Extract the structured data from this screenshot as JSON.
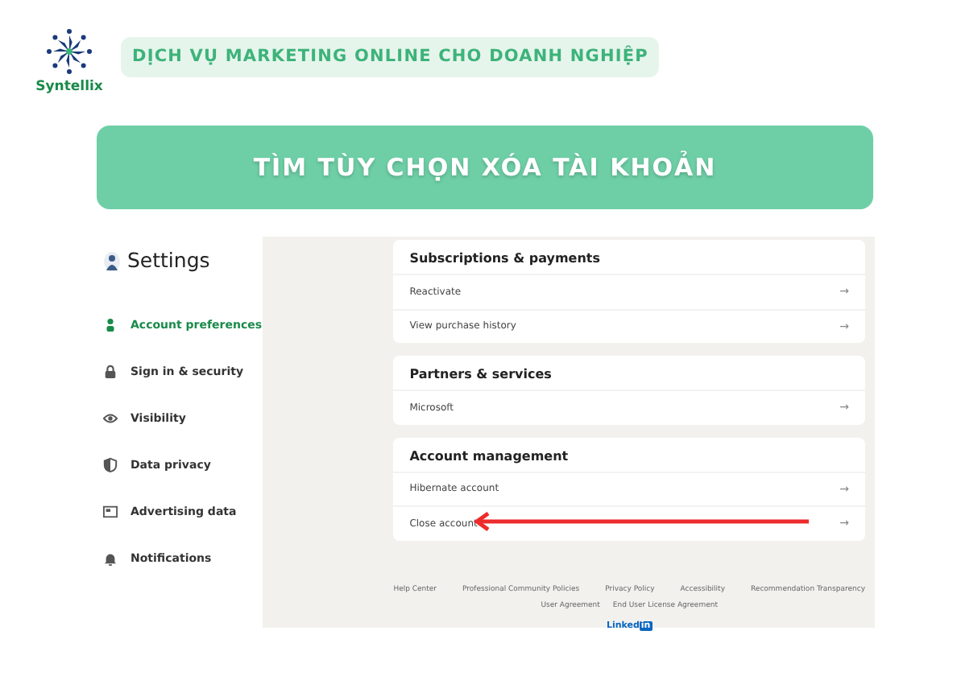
{
  "brand": {
    "name": "Syntellix",
    "tagline": "DỊCH VỤ MARKETING ONLINE CHO DOANH NGHIỆP"
  },
  "banner": {
    "title": "TÌM TÙY CHỌN XÓA TÀI KHOẢN"
  },
  "screenshot": {
    "sidebar": {
      "title": "Settings",
      "items": [
        {
          "label": "Account preferences",
          "selected": true
        },
        {
          "label": "Sign in & security",
          "selected": false
        },
        {
          "label": "Visibility",
          "selected": false
        },
        {
          "label": "Data privacy",
          "selected": false
        },
        {
          "label": "Advertising data",
          "selected": false
        },
        {
          "label": "Notifications",
          "selected": false
        }
      ]
    },
    "sections": [
      {
        "title": "Subscriptions & payments",
        "rows": [
          {
            "label": "Reactivate",
            "arrow": "→",
            "highlighted": false
          },
          {
            "label": "View purchase history",
            "arrow": "→",
            "highlighted": false
          }
        ]
      },
      {
        "title": "Partners & services",
        "rows": [
          {
            "label": "Microsoft",
            "arrow": "→",
            "highlighted": false
          }
        ]
      },
      {
        "title": "Account management",
        "rows": [
          {
            "label": "Hibernate account",
            "arrow": "→",
            "highlighted": false
          },
          {
            "label": "Close account",
            "arrow": "→",
            "highlighted": true
          }
        ]
      }
    ],
    "footer": {
      "links": [
        "Help Center",
        "Professional Community Policies",
        "Privacy Policy",
        "Accessibility",
        "Recommendation Transparency"
      ],
      "links_2": [
        "User Agreement",
        "End User License Agreement"
      ],
      "logo_word": "Linked",
      "logo_box": "in"
    }
  }
}
